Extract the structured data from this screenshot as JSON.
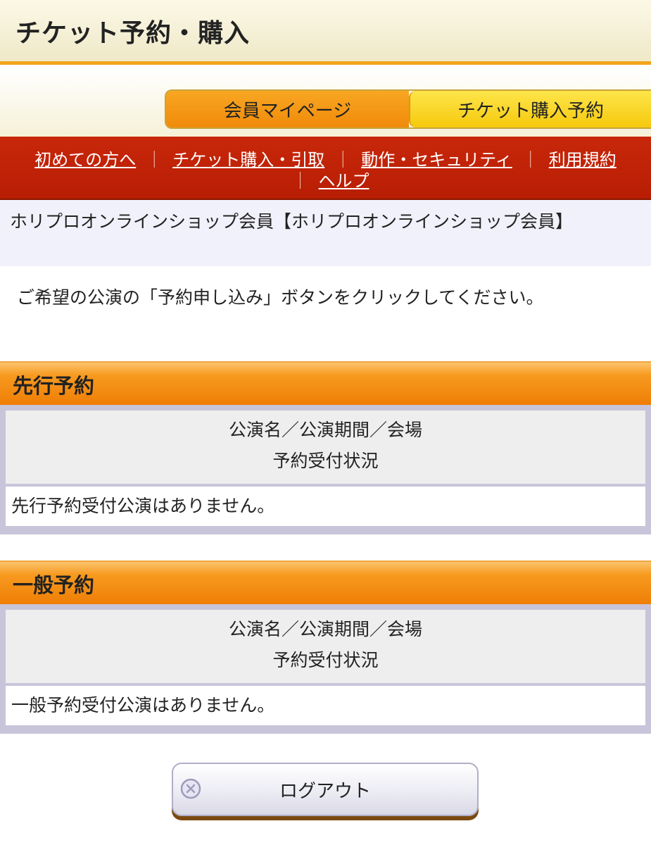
{
  "header": {
    "title": "チケット予約・購入"
  },
  "tabs": [
    {
      "label": "会員マイページ"
    },
    {
      "label": "チケット購入予約"
    }
  ],
  "nav": {
    "links": [
      "初めての方へ",
      "チケット購入・引取",
      "動作・セキュリティ",
      "利用規約",
      "ヘルプ"
    ],
    "separator": "｜"
  },
  "member": {
    "text": "ホリプロオンラインショップ会員【ホリプロオンラインショップ会員】"
  },
  "instruction": "ご希望の公演の「予約申し込み」ボタンをクリックしてください。",
  "sections": [
    {
      "title": "先行予約",
      "col_line1": "公演名／公演期間／会場",
      "col_line2": "予約受付状況",
      "empty": "先行予約受付公演はありません。"
    },
    {
      "title": "一般予約",
      "col_line1": "公演名／公演期間／会場",
      "col_line2": "予約受付状況",
      "empty": "一般予約受付公演はありません。"
    }
  ],
  "logout": {
    "label": "ログアウト",
    "icon": "close-circle-icon"
  }
}
